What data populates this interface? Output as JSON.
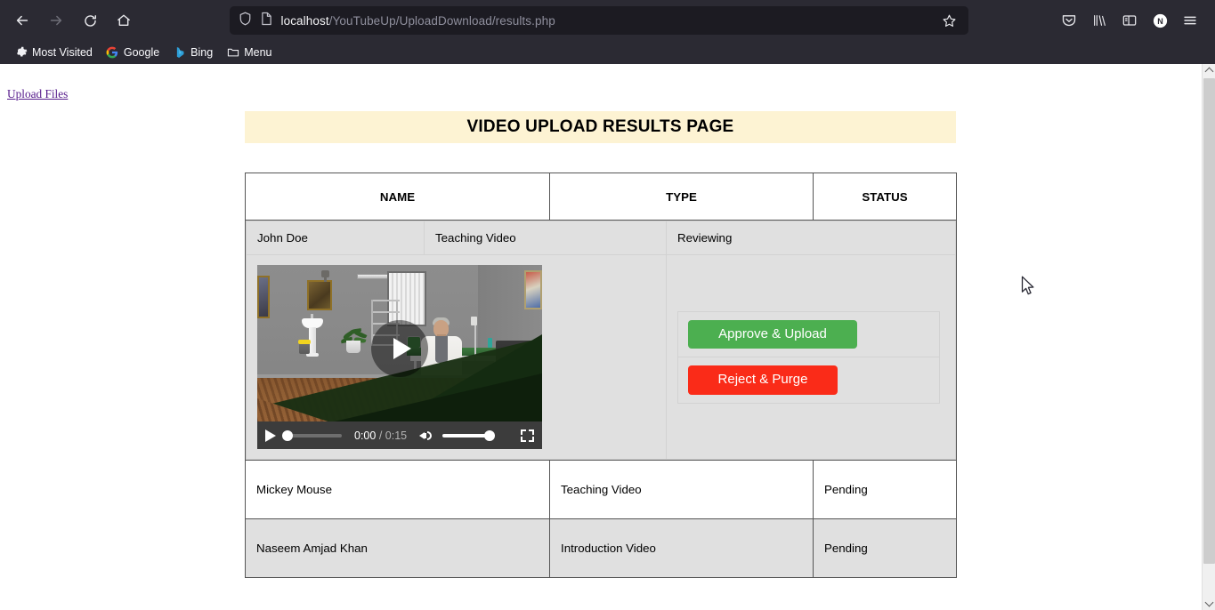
{
  "browser": {
    "nav": {
      "back": "back-arrow",
      "forward": "forward-arrow",
      "reload": "reload",
      "home": "home"
    },
    "url": {
      "host": "localhost",
      "path": "/YouTubeUp/UploadDownload/results.php",
      "shield_icon": "shield-icon",
      "page_icon": "page-icon",
      "bookmark_icon": "star-icon"
    },
    "toolbar_right": [
      {
        "name": "pocket-icon",
        "label": "Pocket"
      },
      {
        "name": "library-icon",
        "label": "Library"
      },
      {
        "name": "sidebar-icon",
        "label": "Sidebar"
      },
      {
        "name": "account-icon",
        "label": "N"
      },
      {
        "name": "menu-icon",
        "label": "Menu"
      }
    ],
    "bookmarks": [
      {
        "icon": "gear-icon",
        "label": "Most Visited"
      },
      {
        "icon": "google-icon",
        "label": "Google"
      },
      {
        "icon": "bing-icon",
        "label": "Bing"
      },
      {
        "icon": "folder-icon",
        "label": "Menu"
      }
    ]
  },
  "page": {
    "upload_link": "Upload Files",
    "title": "VIDEO UPLOAD RESULTS PAGE",
    "title_bg": "#fdf3d3",
    "table": {
      "headers": [
        "NAME",
        "TYPE",
        "STATUS"
      ],
      "rows": [
        {
          "name": "John Doe",
          "type": "Teaching Video",
          "status": "Reviewing",
          "expanded": true
        },
        {
          "name": "Mickey Mouse",
          "type": "Teaching Video",
          "status": "Pending",
          "expanded": false
        },
        {
          "name": "Naseem Amjad Khan",
          "type": "Introduction Video",
          "status": "Pending",
          "expanded": false
        }
      ]
    },
    "actions": {
      "approve_label": "Approve & Upload",
      "approve_color": "#4caf50",
      "reject_label": "Reject & Purge",
      "reject_color": "#fa2b18"
    },
    "video": {
      "current_time": "0:00",
      "separator": "/",
      "duration": "0:15",
      "play_icon": "play-icon",
      "volume_icon": "volume-icon",
      "fullscreen_icon": "fullscreen-icon"
    }
  }
}
